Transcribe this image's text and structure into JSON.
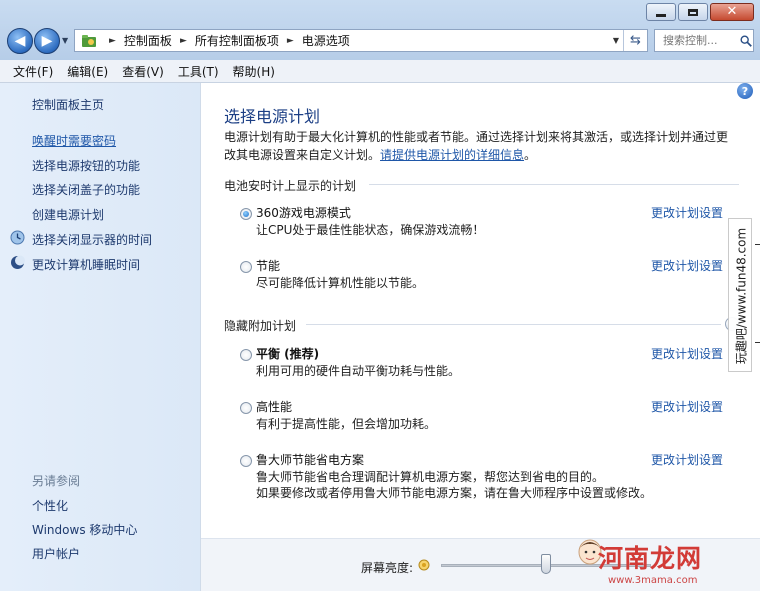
{
  "window": {
    "colors": {
      "frame": "#c4d7ee",
      "link": "#1f57a8",
      "title": "#1c3f85",
      "close": "#c54a30"
    }
  },
  "address": {
    "crumbs": [
      "控制面板",
      "所有控制面板项",
      "电源选项"
    ]
  },
  "search": {
    "placeholder": "搜索控制..."
  },
  "menubar": [
    "文件(F)",
    "编辑(E)",
    "查看(V)",
    "工具(T)",
    "帮助(H)"
  ],
  "sidebar": {
    "home": "控制面板主页",
    "links": [
      {
        "label": "唤醒时需要密码",
        "underlined": true
      },
      {
        "label": "选择电源按钮的功能"
      },
      {
        "label": "选择关闭盖子的功能"
      },
      {
        "label": "创建电源计划"
      },
      {
        "label": "选择关闭显示器的时间",
        "icon": "monitor-icon"
      },
      {
        "label": "更改计算机睡眠时间",
        "icon": "moon-icon"
      }
    ],
    "see_also": "另请参阅",
    "see_also_links": [
      "个性化",
      "Windows 移动中心",
      "用户帐户"
    ]
  },
  "main": {
    "title": "选择电源计划",
    "intro": "电源计划有助于最大化计算机的性能或者节能。通过选择计划来将其激活，或选择计划并通过更改其电源设置来自定义计划。",
    "intro_link": "请提供电源计划的详细信息",
    "intro_end": "。",
    "group_battery": "电池安时计上显示的计划",
    "group_hidden": "隐藏附加计划",
    "change_label": "更改计划设置",
    "plans": [
      {
        "name": "360游戏电源模式",
        "desc": "让CPU处于最佳性能状态，确保游戏流畅！",
        "selected": true
      },
      {
        "name": "节能",
        "desc": "尽可能降低计算机性能以节能。",
        "selected": false
      },
      {
        "name": "平衡 (推荐)",
        "desc": "利用可用的硬件自动平衡功耗与性能。",
        "selected": false
      },
      {
        "name": "高性能",
        "desc": "有利于提高性能，但会增加功耗。",
        "selected": false
      },
      {
        "name": "鲁大师节能省电方案",
        "desc": "鲁大师节能省电合理调配计算机电源方案，帮您达到省电的目的。",
        "desc2": "如果要修改或者停用鲁大师节能电源方案，请在鲁大师程序中设置或修改。",
        "selected": false
      }
    ],
    "brightness_label": "屏幕亮度:",
    "brightness_level": 0.5
  },
  "watermarks": {
    "side": "玩趣吧/www.fun48.com",
    "logo": "河南龙网",
    "url": "www.3mama.com"
  }
}
